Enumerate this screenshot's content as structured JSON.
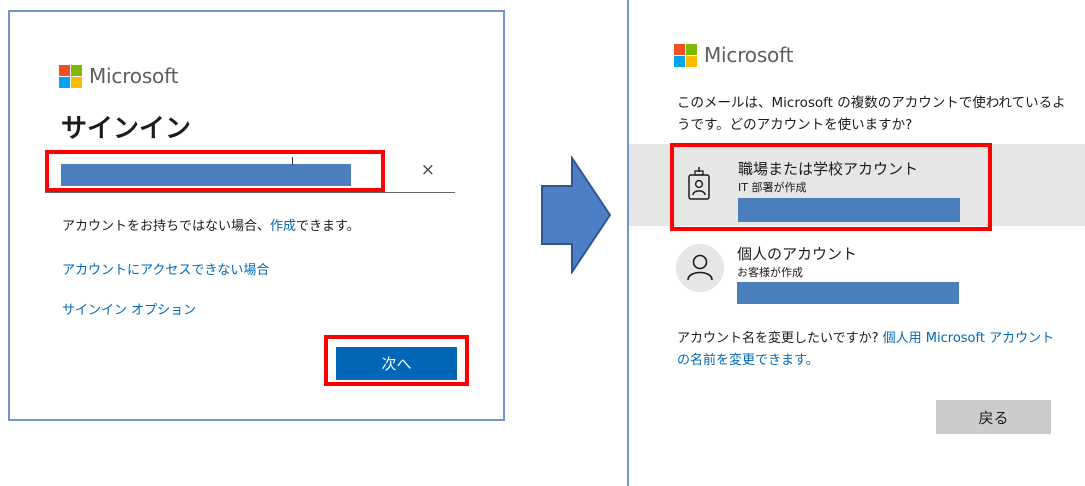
{
  "brand": {
    "name": "Microsoft",
    "colors": {
      "red": "#f25022",
      "green": "#7fba00",
      "blue": "#00a4ef",
      "yellow": "#ffb900"
    }
  },
  "signin": {
    "title": "サインイン",
    "email_value": "",
    "clear_icon": "×",
    "no_account_prefix": "アカウントをお持ちではない場合、",
    "create_link": "作成",
    "no_account_suffix": "できます。",
    "cant_access_link": "アカウントにアクセスできない場合",
    "signin_options_link": "サインイン オプション",
    "next_label": "次へ"
  },
  "pick_account": {
    "message": "このメールは、Microsoft の複数のアカウントで使われているようです。どのアカウントを使いますか?",
    "work": {
      "title": "職場または学校アカウント",
      "subtitle": "IT 部署が作成",
      "icon": "id-badge-icon"
    },
    "personal": {
      "title": "個人のアカウント",
      "subtitle": "お客様が作成",
      "icon": "person-icon"
    },
    "rename_prefix": "アカウント名を変更したいですか? ",
    "rename_link": "個人用 Microsoft アカウントの名前を変更できます。",
    "back_label": "戻る"
  },
  "colors": {
    "highlight_box": "#ff0000",
    "primary_button": "#0067b8",
    "link": "#0067b8",
    "redaction": "#4a7ebd",
    "arrow": "#4e7ec3"
  }
}
